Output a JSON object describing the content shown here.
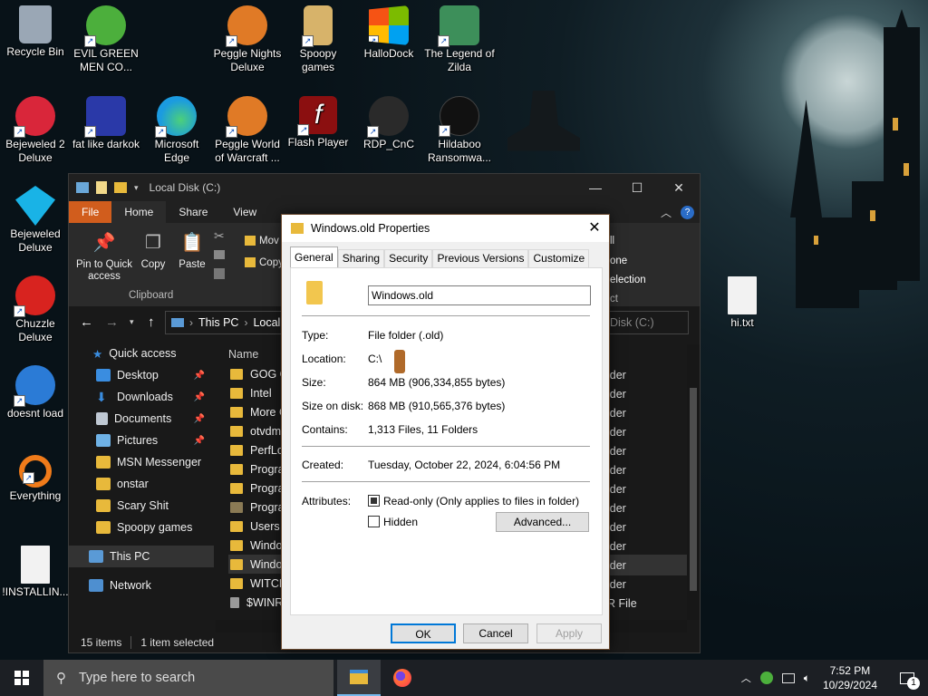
{
  "desktop": {
    "icons": [
      {
        "label": "Recycle Bin",
        "icon": "recycle-bin-icon",
        "color": "#9aa7b5"
      },
      {
        "label": "EVIL GREEN MEN CO...",
        "icon": "msn-green-men-icon",
        "color": "#4caf3c"
      },
      {
        "label": "Peggle Nights Deluxe",
        "icon": "peggle-icon",
        "color": "#e07a26"
      },
      {
        "label": "Spoopy games",
        "icon": "spoopy-games-icon",
        "color": "#d7b36a"
      },
      {
        "label": "HalloDock",
        "icon": "windows-logo-icon",
        "color": "#e8442b"
      },
      {
        "label": "The Legend of Zilda",
        "icon": "zelda-character-icon",
        "color": "#3d8f5a"
      },
      {
        "label": "Bejeweled 2 Deluxe",
        "icon": "bejeweled2-icon",
        "color": "#d9263a"
      },
      {
        "label": "fat like darkok",
        "icon": "mpl-icon",
        "color": "#2a39a8"
      },
      {
        "label": "Microsoft Edge",
        "icon": "edge-icon",
        "color": "#1b9be0"
      },
      {
        "label": "Peggle World of Warcraft ...",
        "icon": "peggle-icon",
        "color": "#e07a26"
      },
      {
        "label": "Flash Player",
        "icon": "flash-player-icon",
        "color": "#8b0f10"
      },
      {
        "label": "RDP_CnC",
        "icon": "rdp-icon",
        "color": "#2a2a2a"
      },
      {
        "label": "Hildaboo Ransomwa...",
        "icon": "yashma-icon",
        "color": "#111111"
      },
      {
        "label": "Bejeweled Deluxe",
        "icon": "diamond-icon",
        "color": "#19b3e6"
      },
      {
        "label": "Chuzzle Deluxe",
        "icon": "chuzzle-icon",
        "color": "#d8231f"
      },
      {
        "label": "doesnt load",
        "icon": "thunderbird-icon",
        "color": "#2b7bd6"
      },
      {
        "label": "Everything",
        "icon": "everything-search-icon",
        "color": "#f07b1a"
      },
      {
        "label": "!INSTALLIN...",
        "icon": "text-file-icon",
        "color": "#f2f2f2"
      },
      {
        "label": "hi.txt",
        "icon": "text-file-icon",
        "color": "#f2f2f2"
      }
    ]
  },
  "explorer": {
    "title": "Local Disk (C:)",
    "tabs": [
      "File",
      "Home",
      "Share",
      "View"
    ],
    "ribbon": {
      "pin": "Pin to Quick access",
      "copy": "Copy",
      "paste": "Paste",
      "move": "Mov",
      "copy_to": "Copy",
      "group_clipboard": "Clipboard",
      "right_1": "ll",
      "right_2": "one",
      "right_3": "election",
      "right_4": "ct"
    },
    "address": {
      "this_pc": "This PC",
      "crumb": "Local",
      "search": "Disk (C:)"
    },
    "nav": [
      {
        "label": "Quick access",
        "icon": "star-icon",
        "pinned": false
      },
      {
        "label": "Desktop",
        "icon": "desktop-folder-icon",
        "pinned": true
      },
      {
        "label": "Downloads",
        "icon": "downloads-arrow-icon",
        "pinned": true
      },
      {
        "label": "Documents",
        "icon": "documents-icon",
        "pinned": true
      },
      {
        "label": "Pictures",
        "icon": "pictures-icon",
        "pinned": true
      },
      {
        "label": "MSN Messenger",
        "icon": "folder-icon",
        "pinned": false
      },
      {
        "label": "onstar",
        "icon": "folder-icon",
        "pinned": false
      },
      {
        "label": "Scary Shit",
        "icon": "folder-icon",
        "pinned": false
      },
      {
        "label": "Spoopy games",
        "icon": "folder-icon",
        "pinned": false
      },
      {
        "label": "This PC",
        "icon": "this-pc-icon",
        "pinned": false
      },
      {
        "label": "Network",
        "icon": "network-icon",
        "pinned": false
      }
    ],
    "column_name": "Name",
    "files": [
      {
        "name": "GOG G",
        "type": "lder"
      },
      {
        "name": "Intel",
        "type": "lder"
      },
      {
        "name": "More G",
        "type": "lder"
      },
      {
        "name": "otvdm",
        "type": "lder"
      },
      {
        "name": "PerfLog",
        "type": "lder"
      },
      {
        "name": "Progra",
        "type": "lder"
      },
      {
        "name": "Progra",
        "type": "lder"
      },
      {
        "name": "Progra",
        "type": "lder"
      },
      {
        "name": "Users",
        "type": "lder"
      },
      {
        "name": "Windo",
        "type": "lder"
      },
      {
        "name": "Windo",
        "type": "lder"
      },
      {
        "name": "WITCH",
        "type": "lder"
      },
      {
        "name": "$WINR",
        "type": "R File"
      }
    ],
    "status": {
      "items": "15 items",
      "selected": "1 item selected"
    }
  },
  "dialog": {
    "title": "Windows.old Properties",
    "tabs": [
      "General",
      "Sharing",
      "Security",
      "Previous Versions",
      "Customize"
    ],
    "name_value": "Windows.old",
    "rows": [
      {
        "label": "Type:",
        "value": "File folder (.old)"
      },
      {
        "label": "Location:",
        "value": "C:\\"
      },
      {
        "label": "Size:",
        "value": "864 MB (906,334,855 bytes)"
      },
      {
        "label": "Size on disk:",
        "value": "868 MB (910,565,376 bytes)"
      },
      {
        "label": "Contains:",
        "value": "1,313 Files, 11 Folders"
      }
    ],
    "created_label": "Created:",
    "created_value": "Tuesday, October 22, 2024, 6:04:56 PM",
    "attributes_label": "Attributes:",
    "readonly_label": "Read-only (Only applies to files in folder)",
    "hidden_label": "Hidden",
    "advanced": "Advanced...",
    "ok": "OK",
    "cancel": "Cancel",
    "apply": "Apply"
  },
  "taskbar": {
    "search_placeholder": "Type here to search",
    "time": "7:52 PM",
    "date": "10/29/2024",
    "notifications": "1"
  }
}
